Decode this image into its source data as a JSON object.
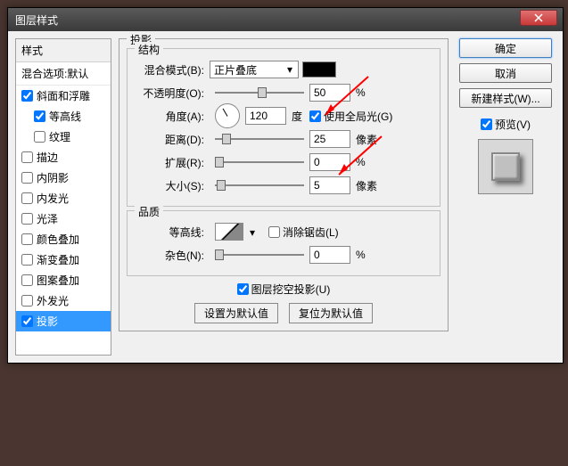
{
  "dialog": {
    "title": "图层样式"
  },
  "styles": {
    "header": "样式",
    "blend": "混合选项:默认",
    "items": [
      {
        "label": "斜面和浮雕",
        "checked": true,
        "indent": false
      },
      {
        "label": "等高线",
        "checked": true,
        "indent": true
      },
      {
        "label": "纹理",
        "checked": false,
        "indent": true
      },
      {
        "label": "描边",
        "checked": false,
        "indent": false
      },
      {
        "label": "内阴影",
        "checked": false,
        "indent": false
      },
      {
        "label": "内发光",
        "checked": false,
        "indent": false
      },
      {
        "label": "光泽",
        "checked": false,
        "indent": false
      },
      {
        "label": "颜色叠加",
        "checked": false,
        "indent": false
      },
      {
        "label": "渐变叠加",
        "checked": false,
        "indent": false
      },
      {
        "label": "图案叠加",
        "checked": false,
        "indent": false
      },
      {
        "label": "外发光",
        "checked": false,
        "indent": false
      },
      {
        "label": "投影",
        "checked": true,
        "indent": false,
        "selected": true
      }
    ]
  },
  "panel": {
    "heading": "投影",
    "structure": {
      "title": "结构",
      "blend_mode_label": "混合模式(B):",
      "blend_mode_value": "正片叠底",
      "color": "#000000",
      "opacity_label": "不透明度(O):",
      "opacity_value": "50",
      "opacity_unit": "%",
      "angle_label": "角度(A):",
      "angle_value": "120",
      "angle_unit": "度",
      "global_light": "使用全局光(G)",
      "distance_label": "距离(D):",
      "distance_value": "25",
      "distance_unit": "像素",
      "spread_label": "扩展(R):",
      "spread_value": "0",
      "spread_unit": "%",
      "size_label": "大小(S):",
      "size_value": "5",
      "size_unit": "像素"
    },
    "quality": {
      "title": "品质",
      "contour_label": "等高线:",
      "antialias": "消除锯齿(L)",
      "noise_label": "杂色(N):",
      "noise_value": "0",
      "noise_unit": "%"
    },
    "knockout": "图层挖空投影(U)",
    "set_default": "设置为默认值",
    "reset_default": "复位为默认值"
  },
  "buttons": {
    "ok": "确定",
    "cancel": "取消",
    "new_style": "新建样式(W)...",
    "preview": "预览(V)"
  }
}
